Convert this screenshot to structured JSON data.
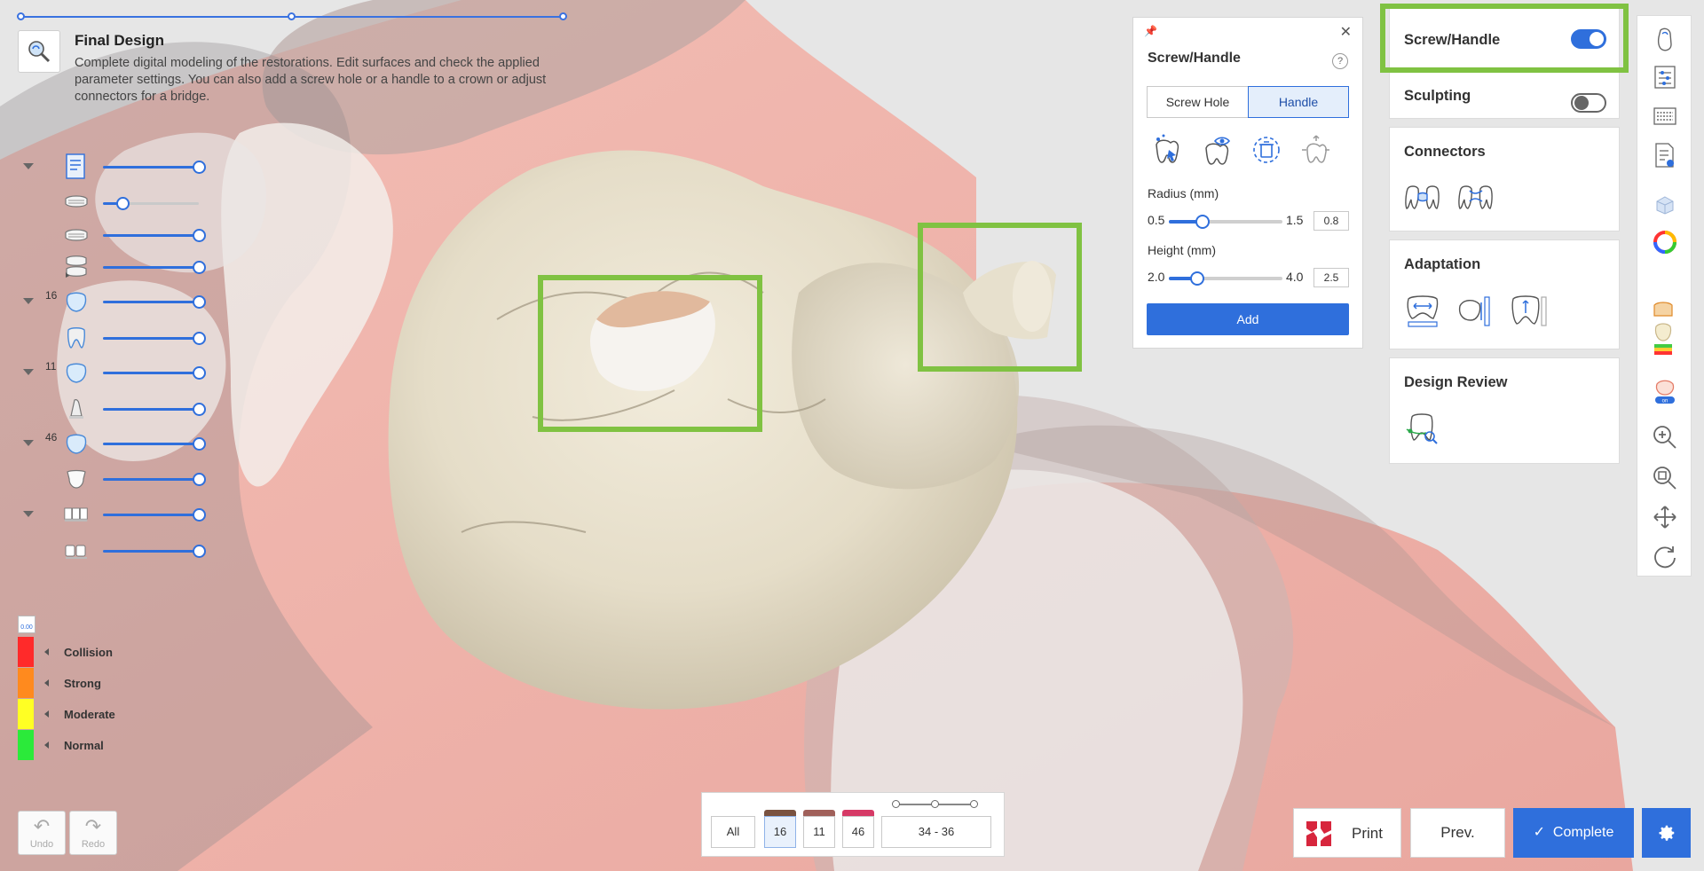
{
  "header": {
    "title": "Final Design",
    "description": "Complete digital modeling of the restorations. Edit surfaces and check the applied parameter settings. You can also add a screw hole or a handle to a crown or adjust connectors for a bridge."
  },
  "layers": [
    {
      "group": "",
      "icon": "report-icon",
      "level": 1.0
    },
    {
      "group": "",
      "icon": "upper-scan-icon",
      "level": 0.2
    },
    {
      "group": "",
      "icon": "lower-scan-icon",
      "level": 1.0
    },
    {
      "group": "",
      "icon": "bite-scan-icon",
      "level": 1.0
    },
    {
      "group": "16",
      "icon": "crown-icon",
      "level": 1.0
    },
    {
      "group": "",
      "icon": "bridge-connector-icon",
      "level": 1.0
    },
    {
      "group": "11",
      "icon": "crown-icon",
      "level": 1.0
    },
    {
      "group": "",
      "icon": "abutment-icon",
      "level": 1.0
    },
    {
      "group": "46",
      "icon": "crown-icon",
      "level": 1.0
    },
    {
      "group": "",
      "icon": "tooth-preparation-icon",
      "level": 1.0
    },
    {
      "group": "",
      "icon": "antagonist-icon",
      "level": 1.0
    },
    {
      "group": "",
      "icon": "adjacent-teeth-icon",
      "level": 1.0
    }
  ],
  "legend": {
    "toggle_value": "0.00",
    "items": [
      {
        "label": "Collision",
        "color": "#ff2a2a"
      },
      {
        "label": "Strong",
        "color": "#ff8a1e"
      },
      {
        "label": "Moderate",
        "color": "#ffff24"
      },
      {
        "label": "Normal",
        "color": "#2bea3a"
      }
    ]
  },
  "history": {
    "undo": "Undo",
    "redo": "Redo"
  },
  "tooth_selector": {
    "all": "All",
    "teeth": [
      {
        "label": "16",
        "color": "#7a5240",
        "active": true
      },
      {
        "label": "11",
        "color": "#a0605a",
        "active": false
      },
      {
        "label": "46",
        "color": "#d63a66",
        "active": false
      }
    ],
    "range": "34 - 36"
  },
  "actions": {
    "print": "Print",
    "prev": "Prev.",
    "complete": "Complete"
  },
  "screw_handle_popup": {
    "title": "Screw/Handle",
    "help": "?",
    "tabs": [
      "Screw Hole",
      "Handle"
    ],
    "active_tab": "Handle",
    "tools": [
      "auto-place-icon",
      "visibility-icon",
      "delete-icon",
      "move-icon"
    ],
    "radius": {
      "label": "Radius (mm)",
      "min": "0.5",
      "max": "1.5",
      "value": "0.8",
      "fraction": 0.3
    },
    "height": {
      "label": "Height (mm)",
      "min": "2.0",
      "max": "4.0",
      "value": "2.5",
      "fraction": 0.25
    },
    "add_label": "Add"
  },
  "side_panels": {
    "screw_handle": {
      "label": "Screw/Handle",
      "on": true
    },
    "sculpting": {
      "label": "Sculpting",
      "on": false
    },
    "connectors": {
      "title": "Connectors",
      "tools": [
        "connector-adjust-icon",
        "connector-sculpt-icon"
      ]
    },
    "adaptation": {
      "title": "Adaptation",
      "tools": [
        "adapt-width-icon",
        "adapt-side-icon",
        "adapt-height-icon"
      ]
    },
    "design_review": {
      "title": "Design Review",
      "tools": [
        "design-review-icon"
      ]
    }
  },
  "toolbar": [
    "scan-data-icon",
    "parameters-icon",
    "keyboard-icon",
    "report-icon",
    "cube-view-icon",
    "color-wheel-icon",
    "gradient-map-icon",
    "margin-on-icon",
    "zoom-in-icon",
    "zoom-fit-icon",
    "pan-icon",
    "rotate-icon"
  ],
  "colors": {
    "accent": "#2f6fdc",
    "highlight": "#80c242",
    "gum": "#f0b5ad",
    "tooth": "#e6dfcb"
  }
}
